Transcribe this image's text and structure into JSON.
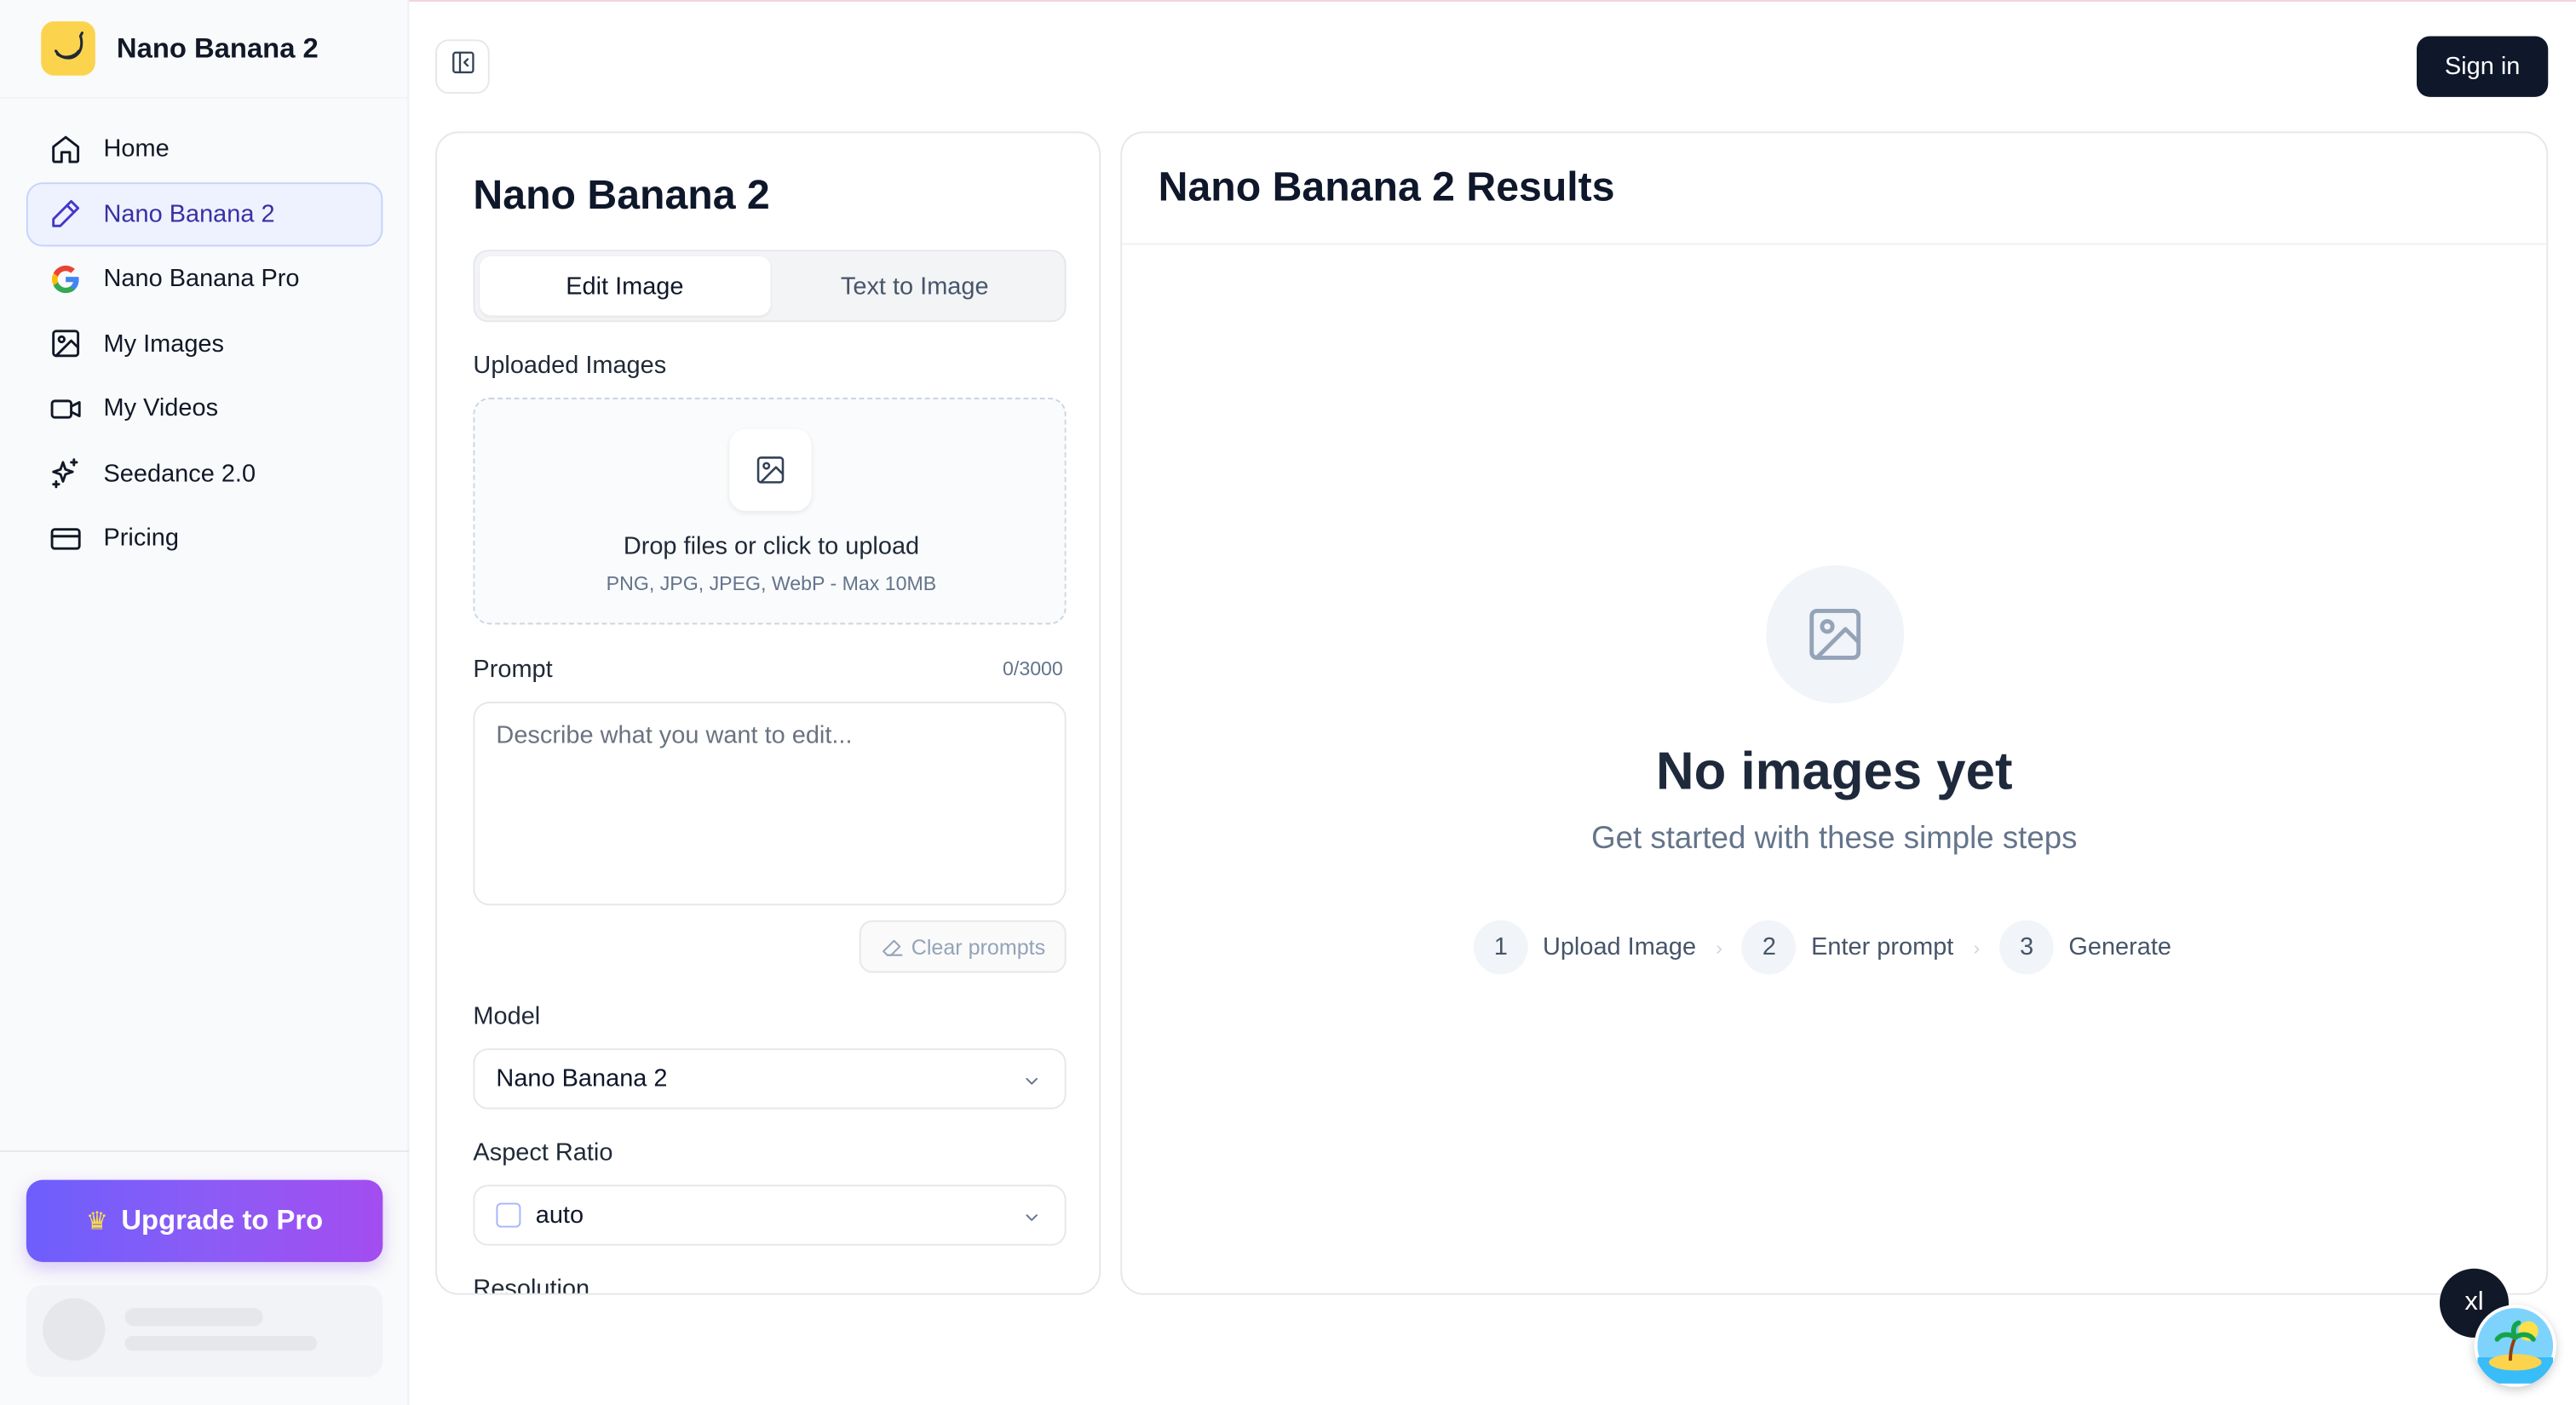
{
  "app": {
    "name": "Nano Banana 2"
  },
  "sidebar": {
    "items": [
      {
        "label": "Home",
        "icon": "home-icon"
      },
      {
        "label": "Nano Banana 2",
        "icon": "pen-icon",
        "active": true
      },
      {
        "label": "Nano Banana Pro",
        "icon": "google-icon"
      },
      {
        "label": "My Images",
        "icon": "image-icon"
      },
      {
        "label": "My Videos",
        "icon": "video-icon"
      },
      {
        "label": "Seedance 2.0",
        "icon": "sparkles-icon"
      },
      {
        "label": "Pricing",
        "icon": "card-icon"
      }
    ],
    "upgrade_label": "Upgrade to Pro"
  },
  "header": {
    "sign_in_label": "Sign in"
  },
  "editor": {
    "title": "Nano Banana 2",
    "tabs": [
      {
        "label": "Edit Image",
        "active": true
      },
      {
        "label": "Text to Image",
        "active": false
      }
    ],
    "uploaded_label": "Uploaded Images",
    "upload_main": "Drop files or click to upload",
    "upload_sub": "PNG, JPG, JPEG, WebP - Max 10MB",
    "prompt_label": "Prompt",
    "prompt_count": "0/3000",
    "prompt_placeholder": "Describe what you want to edit...",
    "clear_label": "Clear prompts",
    "model_label": "Model",
    "model_value": "Nano Banana 2",
    "aspect_label": "Aspect Ratio",
    "aspect_value": "auto",
    "resolution_label": "Resolution"
  },
  "results": {
    "title": "Nano Banana 2 Results",
    "empty_title": "No images yet",
    "empty_sub": "Get started with these simple steps",
    "steps": [
      {
        "num": "1",
        "label": "Upload Image"
      },
      {
        "num": "2",
        "label": "Enter prompt"
      },
      {
        "num": "3",
        "label": "Generate"
      }
    ]
  },
  "floating": {
    "badge_text": "xl"
  },
  "colors": {
    "accent": "#4f46e5",
    "primary_dark": "#0f172a",
    "upgrade_gradient_start": "#6d5efc",
    "upgrade_gradient_end": "#a34df0",
    "brand_yellow": "#fcd34d"
  }
}
